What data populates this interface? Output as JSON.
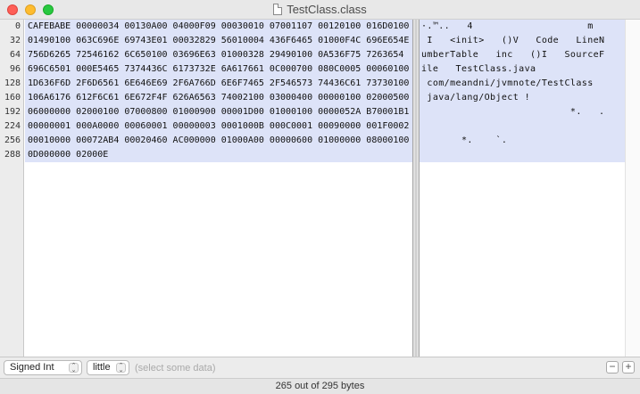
{
  "window": {
    "title": "TestClass.class"
  },
  "offsets": [
    "0",
    "32",
    "64",
    "96",
    "128",
    "160",
    "192",
    "224",
    "256",
    "288"
  ],
  "hex_rows": [
    "CAFEBABE 00000034 00130A00 04000F09 00030010 07001107 00120100 016D0100",
    "01490100 063C696E 69743E01 00032829 56010004 436F6465 01000F4C 696E654E",
    "756D6265 72546162 6C650100 03696E63 01000328 29490100 0A536F75 7263654",
    "696C6501 000E5465 7374436C 6173732E 6A617661 0C000700 080C0005 00060100",
    "1D636F6D 2F6D6561 6E646E69 2F6A766D 6E6F7465 2F546573 74436C61 73730100",
    "106A6176 612F6C61 6E672F4F 626A6563 74002100 03000400 00000100 02000500",
    "06000000 02000100 07000800 01000900 00001D00 01000100 0000052A B70001B1",
    "00000001 000A0000 00060001 00000003 0001000B 000C0001 00090000 001F0002",
    "00010000 00072AB4 00020460 AC000000 01000A00 00000600 01000000 08000100",
    "0D000000 02000E"
  ],
  "ascii_rows": [
    "·.™..   4                    m",
    " I   <init>   ()V   Code   LineN",
    "umberTable   inc   ()I   SourceF",
    "ile   TestClass.java",
    " com/meandni/jvmnote/TestClass",
    " java/lang/Object !",
    "                          *.   .",
    "",
    "       *.    `.",
    ""
  ],
  "bottom": {
    "type_select": "Signed Int",
    "endian_select": "little",
    "placeholder": "(select some data)",
    "minus_label": "−",
    "plus_label": "+"
  },
  "status": {
    "text": "265 out of 295 bytes"
  }
}
